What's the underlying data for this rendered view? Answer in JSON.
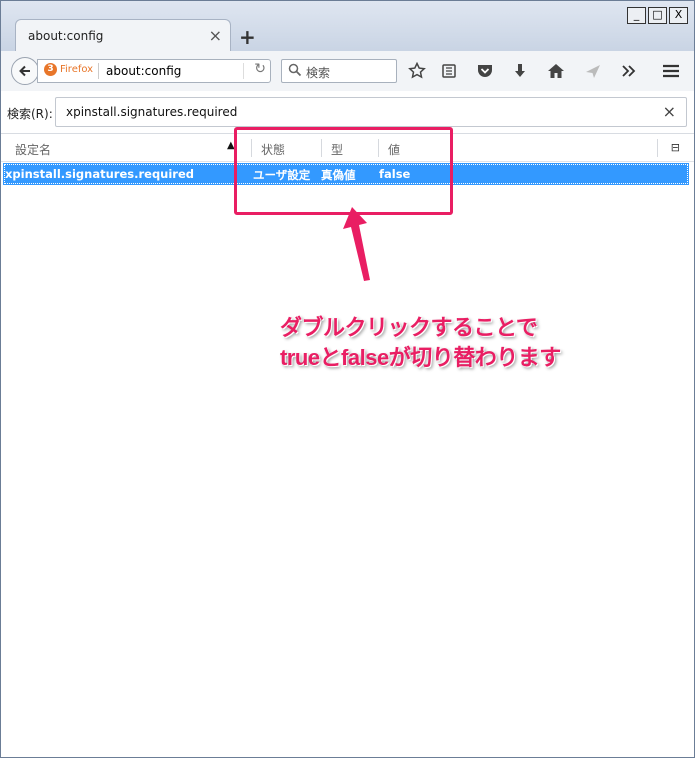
{
  "tab": {
    "title": "about:config",
    "close": "×",
    "new_tab": "+"
  },
  "window_controls": {
    "minimize": "_",
    "maximize": "□",
    "close": "X"
  },
  "navbar": {
    "identity_label": "Firefox",
    "url": "about:config",
    "reload": "↻",
    "search_placeholder": "検索"
  },
  "filter": {
    "label": "検索(R):",
    "value": "xpinstall.signatures.required",
    "clear": "×"
  },
  "columns": {
    "name": "設定名",
    "status": "状態",
    "type": "型",
    "value": "値"
  },
  "sort_indicator": "▲",
  "column_picker": "⊟",
  "row": {
    "name": "xpinstall.signatures.required",
    "status": "ユーザ設定",
    "type": "真偽値",
    "value": "false"
  },
  "annotation": {
    "line1": "ダブルクリックすることで",
    "line2": "trueとfalseが切り替わります",
    "color": "#e91e63"
  },
  "colors": {
    "selection": "#3399ff",
    "accent_orange": "#e8762a"
  }
}
